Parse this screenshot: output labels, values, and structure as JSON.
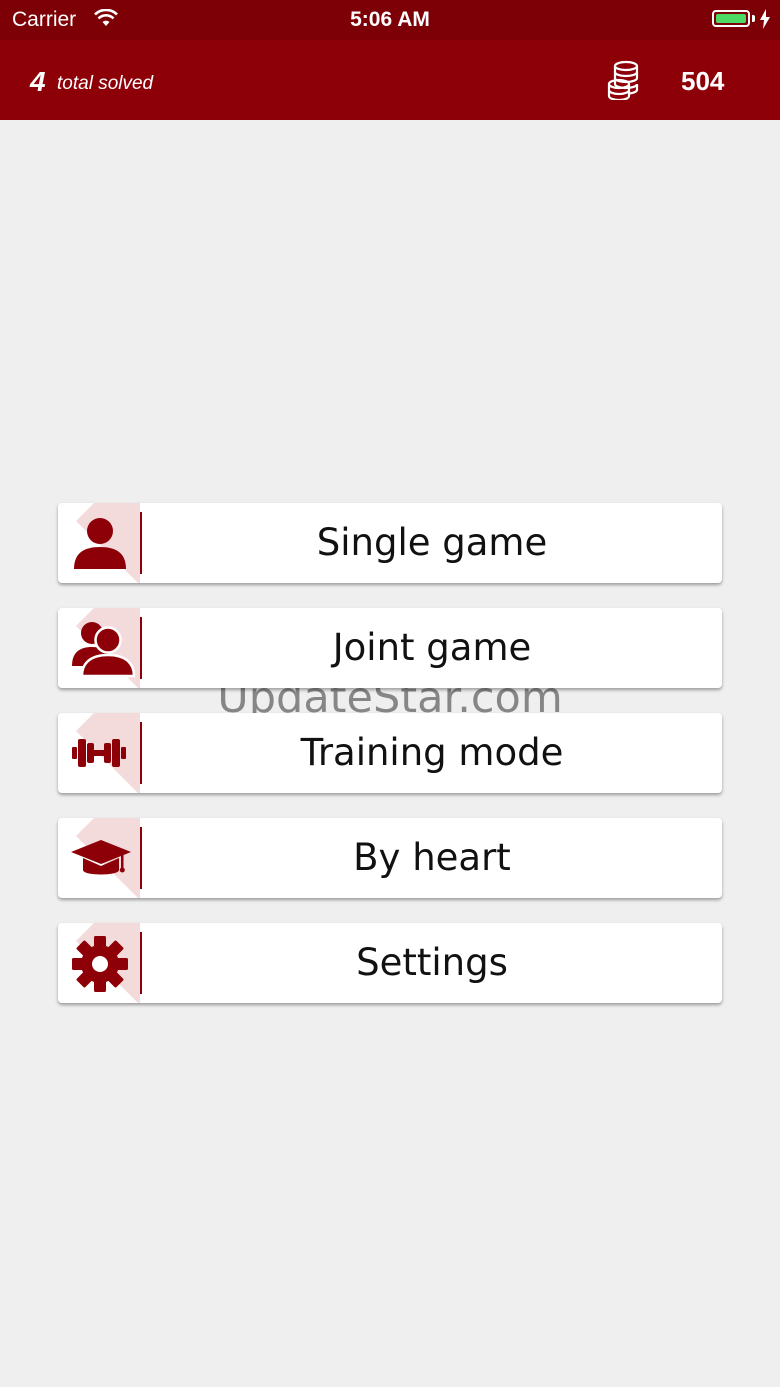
{
  "statusbar": {
    "carrier": "Carrier",
    "time": "5:06 AM"
  },
  "header": {
    "solved_count": "4",
    "solved_label": "total solved",
    "coins": "504"
  },
  "menu": [
    {
      "label": "Single game",
      "icon": "person-icon"
    },
    {
      "label": "Joint game",
      "icon": "people-icon"
    },
    {
      "label": "Training mode",
      "icon": "dumbbell-icon"
    },
    {
      "label": "By heart",
      "icon": "graduation-cap-icon"
    },
    {
      "label": "Settings",
      "icon": "gear-icon"
    }
  ],
  "watermark": "UpdateStar.com",
  "colors": {
    "primary": "#8e0007",
    "statusbar": "#7d0006",
    "background": "#efefef",
    "icon_shadow": "#f3dadb",
    "battery": "#4cd964"
  }
}
